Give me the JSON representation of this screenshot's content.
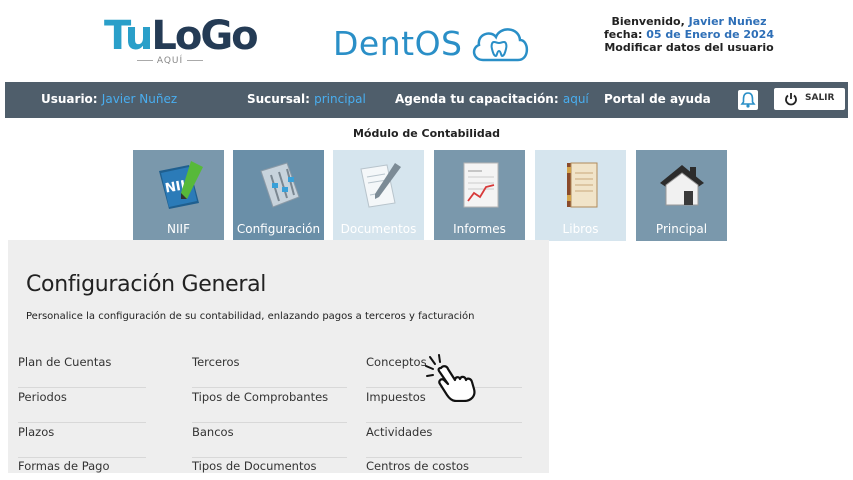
{
  "header": {
    "logo_left": {
      "main": "TuLoGo",
      "sub": "AQUÍ"
    },
    "logo_center": "DentOS",
    "welcome": {
      "line1_prefix": "Bienvenido,",
      "user": "Javier Nuñez",
      "line2_prefix": "fecha:",
      "date": "05 de Enero de 2024",
      "line3": "Modificar datos del usuario"
    }
  },
  "nav": {
    "user_label": "Usuario:",
    "user_value": "Javier Nuñez",
    "branch_label": "Sucursal:",
    "branch_value": "principal",
    "training_label": "Agenda tu capacitación:",
    "training_link": "aquí",
    "help": "Portal de ayuda",
    "logout": "SALIR"
  },
  "module": {
    "title": "Módulo de Contabilidad",
    "tiles": [
      {
        "label": "NIIF"
      },
      {
        "label": "Configuración"
      },
      {
        "label": "Documentos"
      },
      {
        "label": "Informes"
      },
      {
        "label": "Libros"
      },
      {
        "label": "Principal"
      }
    ]
  },
  "panel": {
    "title": "Configuración General",
    "subtitle": "Personalice la configuración de su contabilidad, enlazando pagos a terceros y facturación",
    "col1": [
      "Plan de Cuentas",
      "Periodos",
      "Plazos",
      "Formas de Pago"
    ],
    "col2": [
      "Terceros",
      "Tipos de Comprobantes",
      "Bancos",
      "Tipos de Documentos"
    ],
    "col3": [
      "Conceptos",
      "Impuestos",
      "Actividades",
      "Centros de costos"
    ]
  },
  "colors": {
    "navbar": "#4f5e6b",
    "nav_accent": "#49aef0",
    "tile_active": "#6a8fa8",
    "tile_light": "#d6e5ee",
    "tile_dark": "#7a98ac",
    "panel_bg": "#eeeeee"
  }
}
